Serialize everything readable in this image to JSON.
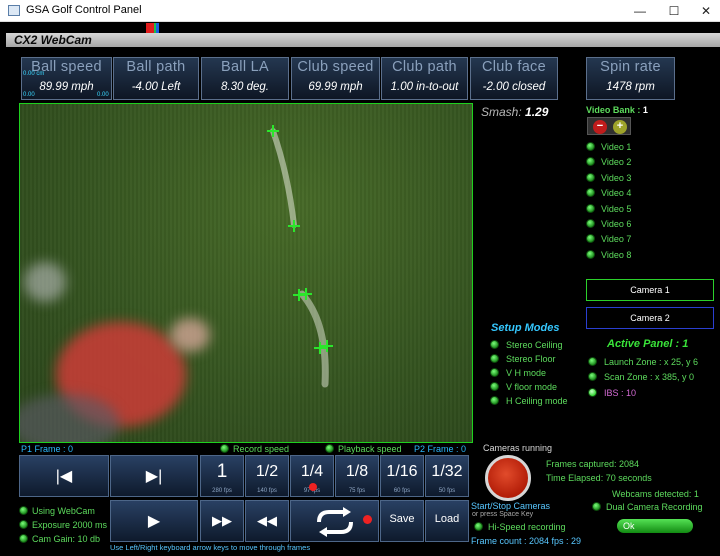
{
  "window": {
    "title": "GSA Golf Control Panel",
    "minimize": "—",
    "maximize": "☐",
    "close": "✕"
  },
  "app_title": "CX2 WebCam",
  "metrics": [
    {
      "label": "Ball speed",
      "value": "89.99 mph"
    },
    {
      "label": "Ball path",
      "value": "-4.00 Left"
    },
    {
      "label": "Ball LA",
      "value": "8.30 deg."
    },
    {
      "label": "Club speed",
      "value": "69.99 mph"
    },
    {
      "label": "Club path",
      "value": "1.00 in-to-out"
    },
    {
      "label": "Club face",
      "value": "-2.00 closed"
    },
    {
      "label": "Spin rate",
      "value": "1478 rpm"
    }
  ],
  "tiny_units": {
    "top": "0.00 cm",
    "bottom_left": "0.00",
    "bottom_right": "0.00"
  },
  "smash": {
    "label": "Smash:",
    "value": "1.29"
  },
  "video_bank": {
    "label": "Video Bank :",
    "value": "1",
    "minus": "−",
    "plus": "+",
    "videos": [
      "Video 1",
      "Video 2",
      "Video 3",
      "Video 4",
      "Video 5",
      "Video 6",
      "Video 7",
      "Video 8"
    ]
  },
  "cameras": {
    "camera1": "Camera 1",
    "camera2": "Camera 2"
  },
  "setup_modes": {
    "title": "Setup Modes",
    "items": [
      "Stereo Ceiling",
      "Stereo Floor",
      "V H mode",
      "V floor mode",
      "H Ceiling mode"
    ]
  },
  "active_panel": {
    "title": "Active Panel : 1",
    "launch_zone": "Launch Zone : x 25, y 6",
    "scan_zone": "Scan Zone : x 385, y 0",
    "ibs": "IBS : 10"
  },
  "status": {
    "p1_frame": "P1 Frame : 0",
    "record_speed": "Record speed",
    "playback_speed": "Playback speed",
    "p2_frame": "P2 Frame : 0"
  },
  "speed_buttons": [
    {
      "label": "1",
      "fps": "280 fps"
    },
    {
      "label": "1/2",
      "fps": "140 fps"
    },
    {
      "label": "1/4",
      "fps": "97 fps"
    },
    {
      "label": "1/8",
      "fps": "75 fps"
    },
    {
      "label": "1/16",
      "fps": "60 fps"
    },
    {
      "label": "1/32",
      "fps": "50 fps"
    }
  ],
  "controls": {
    "save": "Save",
    "load": "Load"
  },
  "webcam": {
    "using": "Using WebCam",
    "exposure": "Exposure 2000 ms",
    "gain": "Cam Gain: 10 db"
  },
  "hint": "Use Left/Right keyboard arrow keys to move through frames",
  "capture": {
    "cameras_running": "Cameras running",
    "frames_captured": "Frames captured: 2084",
    "time_elapsed": "Time Elapsed: 70 seconds",
    "start_stop": "Start/Stop Cameras",
    "space_hint": "or press Space Key",
    "hispeed": "Hi-Speed recording",
    "frame_count": "Frame count : 2084 fps : 29"
  },
  "webcams": {
    "detected": "Webcams detected: 1",
    "dual": "Dual Camera Recording",
    "ok": "Ok"
  },
  "colors": {
    "accent_green": "#1ed11e",
    "accent_blue": "#2bb8ff",
    "record_red": "#c8260d"
  }
}
